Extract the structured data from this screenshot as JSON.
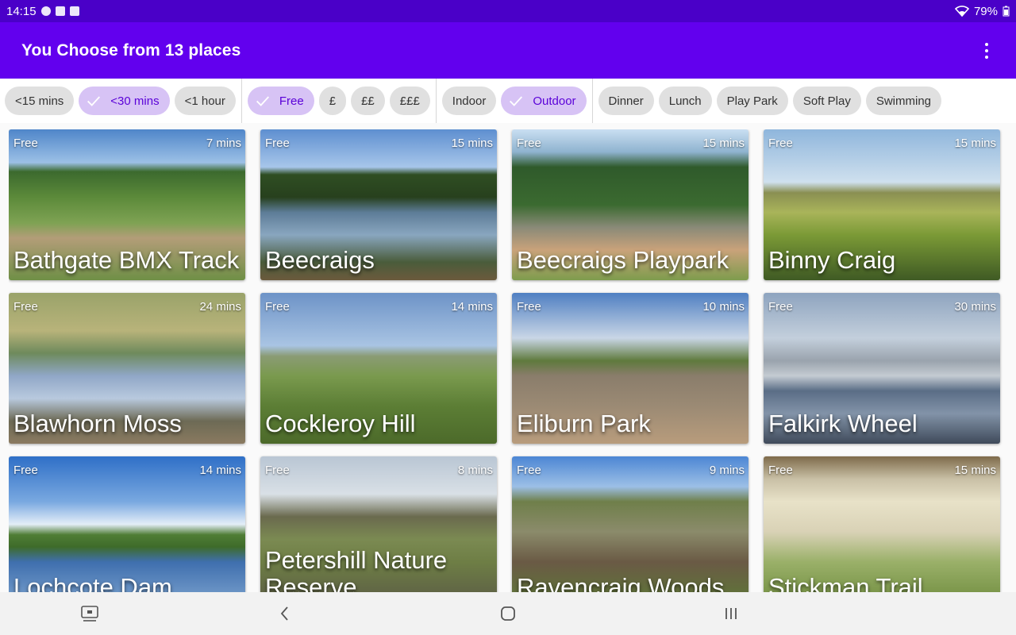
{
  "status_bar": {
    "time": "14:15",
    "battery": "79%"
  },
  "app_bar": {
    "title": "You Choose from 13 places"
  },
  "filters": {
    "time": [
      {
        "label": "<15 mins",
        "selected": false
      },
      {
        "label": "<30 mins",
        "selected": true
      },
      {
        "label": "<1 hour",
        "selected": false
      }
    ],
    "cost": [
      {
        "label": "Free",
        "selected": true
      },
      {
        "label": "£",
        "selected": false
      },
      {
        "label": "££",
        "selected": false
      },
      {
        "label": "£££",
        "selected": false
      }
    ],
    "setting": [
      {
        "label": "Indoor",
        "selected": false
      },
      {
        "label": "Outdoor",
        "selected": true
      }
    ],
    "type": [
      {
        "label": "Dinner",
        "selected": false
      },
      {
        "label": "Lunch",
        "selected": false
      },
      {
        "label": "Play Park",
        "selected": false
      },
      {
        "label": "Soft Play",
        "selected": false
      },
      {
        "label": "Swimming",
        "selected": false
      }
    ]
  },
  "places": [
    {
      "name": "Bathgate BMX Track",
      "cost": "Free",
      "time": "7 mins"
    },
    {
      "name": "Beecraigs",
      "cost": "Free",
      "time": "15 mins"
    },
    {
      "name": "Beecraigs Playpark",
      "cost": "Free",
      "time": "15 mins"
    },
    {
      "name": "Binny Craig",
      "cost": "Free",
      "time": "15 mins"
    },
    {
      "name": "Blawhorn Moss",
      "cost": "Free",
      "time": "24 mins"
    },
    {
      "name": "Cockleroy Hill",
      "cost": "Free",
      "time": "14 mins"
    },
    {
      "name": "Eliburn Park",
      "cost": "Free",
      "time": "10 mins"
    },
    {
      "name": "Falkirk Wheel",
      "cost": "Free",
      "time": "30 mins"
    },
    {
      "name": "Lochcote Dam",
      "cost": "Free",
      "time": "14 mins"
    },
    {
      "name": "Petershill Nature Reserve",
      "cost": "Free",
      "time": "8 mins"
    },
    {
      "name": "Ravencraig Woods",
      "cost": "Free",
      "time": "9 mins"
    },
    {
      "name": "Stickman Trail",
      "cost": "Free",
      "time": "15 mins"
    }
  ],
  "icons": {
    "overflow": "more-vert-icon",
    "check": "check-icon",
    "nav_recents": "recents-icon",
    "nav_home": "home-icon",
    "nav_back": "back-icon",
    "nav_keyboard": "screen-keyboard-icon"
  },
  "colors": {
    "primary": "#6200ee",
    "status": "#4a00c8",
    "chip_selected_bg": "#d7c3f5",
    "chip_selected_text": "#5a00d8"
  }
}
